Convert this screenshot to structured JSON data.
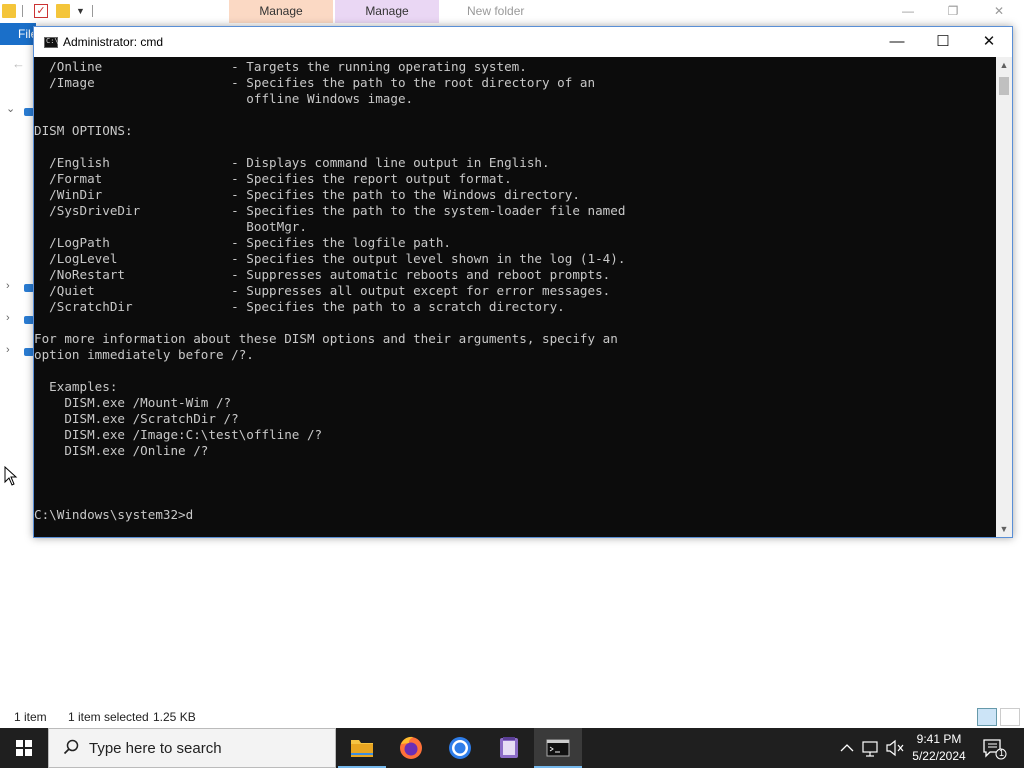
{
  "explorer": {
    "tabs": {
      "manage_1": "Manage",
      "manage_2": "Manage"
    },
    "title": "New folder",
    "ribbon_file": "File",
    "status": {
      "item_count": "1 item",
      "selection": "1 item selected",
      "size": "1.25 KB"
    }
  },
  "cmd": {
    "title": "Administrator: cmd",
    "lines": [
      "  /Online                 - Targets the running operating system.",
      "  /Image                  - Specifies the path to the root directory of an",
      "                            offline Windows image.",
      "",
      "DISM OPTIONS:",
      "",
      "  /English                - Displays command line output in English.",
      "  /Format                 - Specifies the report output format.",
      "  /WinDir                 - Specifies the path to the Windows directory.",
      "  /SysDriveDir            - Specifies the path to the system-loader file named",
      "                            BootMgr.",
      "  /LogPath                - Specifies the logfile path.",
      "  /LogLevel               - Specifies the output level shown in the log (1-4).",
      "  /NoRestart              - Suppresses automatic reboots and reboot prompts.",
      "  /Quiet                  - Suppresses all output except for error messages.",
      "  /ScratchDir             - Specifies the path to a scratch directory.",
      "",
      "For more information about these DISM options and their arguments, specify an",
      "option immediately before /?.",
      "",
      "  Examples:",
      "    DISM.exe /Mount-Wim /?",
      "    DISM.exe /ScratchDir /?",
      "    DISM.exe /Image:C:\\test\\offline /?",
      "    DISM.exe /Online /?",
      "",
      "",
      "",
      "C:\\Windows\\system32>d"
    ]
  },
  "taskbar": {
    "search_placeholder": "Type here to search",
    "apps": [
      "file-explorer",
      "firefox",
      "chrome",
      "notepad-app",
      "command-prompt"
    ],
    "time": "9:41 PM",
    "date": "5/22/2024",
    "notification_count": "1"
  },
  "colors": {
    "accent": "#1a6fc9",
    "terminal_bg": "#0c0c0c",
    "terminal_fg": "#c8c8c8",
    "taskbar_bg": "#1f1f1f"
  }
}
